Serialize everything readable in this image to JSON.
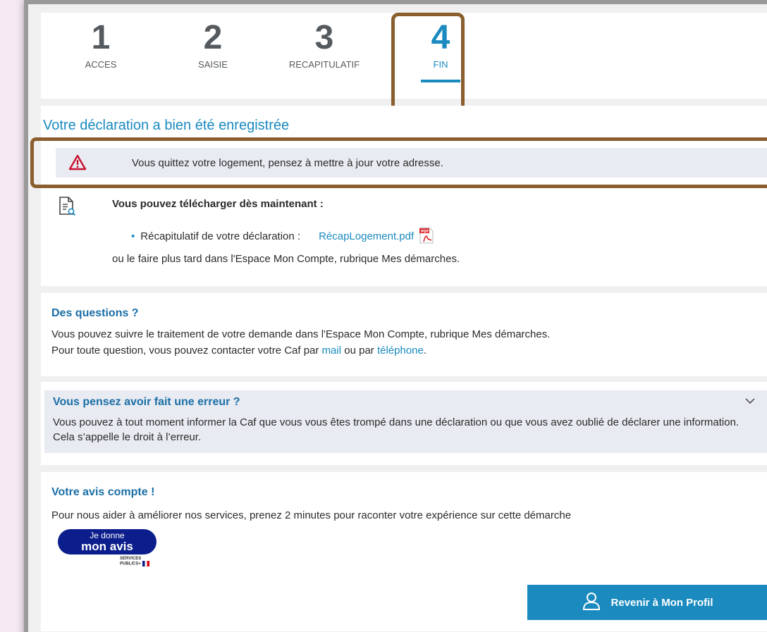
{
  "steps": [
    {
      "num": "1",
      "label": "ACCES"
    },
    {
      "num": "2",
      "label": "SAISIE"
    },
    {
      "num": "3",
      "label": "RECAPITULATIF"
    },
    {
      "num": "4",
      "label": "FIN"
    }
  ],
  "confirmation": {
    "title": "Votre déclaration a bien été enregistrée",
    "alert": "Vous quittez votre logement, pensez à mettre à jour votre adresse.",
    "download_title": "Vous pouvez télécharger dès maintenant :",
    "download_item_label": "Récapitulatif de votre déclaration :",
    "download_file": "RécapLogement.pdf",
    "download_later": "ou le faire plus tard dans l'Espace Mon Compte, rubrique Mes démarches."
  },
  "questions": {
    "title": "Des questions ?",
    "line1": "Vous pouvez suivre le traitement de votre demande dans l'Espace Mon Compte, rubrique Mes démarches.",
    "line2_prefix": "Pour toute question, vous pouvez contacter votre Caf par ",
    "mail_link": "mail",
    "line2_mid": " ou par ",
    "phone_link": "téléphone",
    "line2_suffix": "."
  },
  "error": {
    "title": "Vous pensez avoir fait une erreur ?",
    "text": "Vous pouvez à tout moment informer la Caf que vous vous êtes trompé dans une déclaration ou que vous avez oublié de déclarer une information. Cela s’appelle le droit à l’erreur."
  },
  "feedback": {
    "title": "Votre avis compte !",
    "text": "Pour nous aider à améliorer nos services, prenez 2 minutes pour raconter votre expérience sur cette démarche",
    "badge_line1": "Je donne",
    "badge_line2": "mon avis",
    "logo_line1": "SERVICES",
    "logo_line2": "PUBLICS+"
  },
  "profile_button": "Revenir à Mon Profil",
  "colors": {
    "accent": "#1a8abf",
    "highlight": "#8b5e2e",
    "badge": "#0b1e8c"
  }
}
